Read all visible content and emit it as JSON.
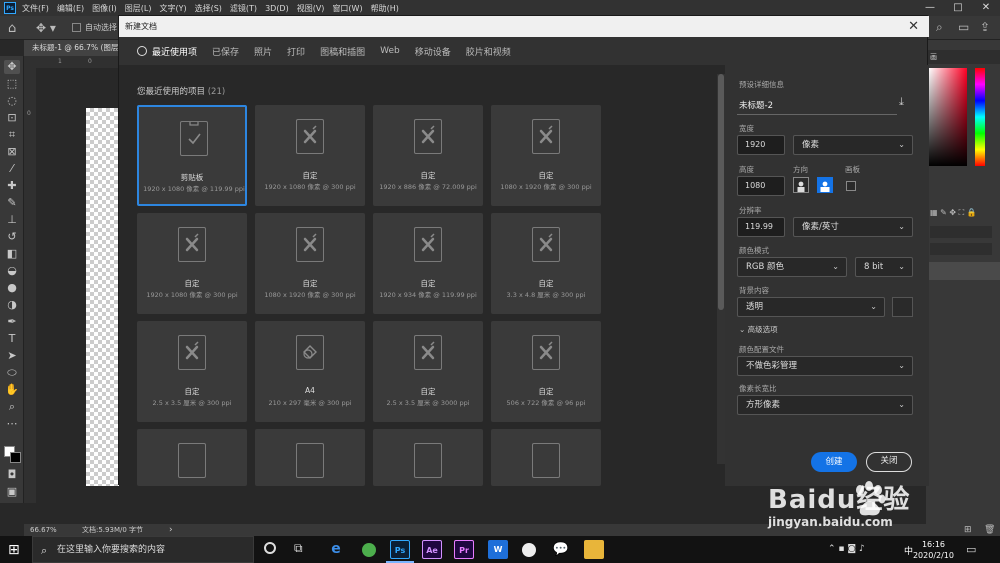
{
  "app": {
    "logo": "Ps",
    "menu": [
      "文件(F)",
      "编辑(E)",
      "图像(I)",
      "图层(L)",
      "文字(Y)",
      "选择(S)",
      "滤镜(T)",
      "3D(D)",
      "视图(V)",
      "窗口(W)",
      "帮助(H)"
    ],
    "window_controls": [
      "—",
      "□",
      "✕"
    ],
    "options_bar": {
      "auto_select_label": "自动选择"
    },
    "doc_tab": "未标题-1 @ 66.7% (图层",
    "ruler_h": [
      "1",
      "0"
    ],
    "ruler_v": [
      "0"
    ],
    "status": {
      "zoom": "66.67%",
      "doc_info": "文档:5.93M/0 字节"
    },
    "right_panel": {
      "tab": "画"
    }
  },
  "dialog": {
    "title": "新建文档",
    "close": "✕",
    "tabs": [
      "最近使用项",
      "已保存",
      "照片",
      "打印",
      "图稿和插图",
      "Web",
      "移动设备",
      "胶片和视频"
    ],
    "recent_label": "您最近使用的项目",
    "recent_count": "(21)",
    "cards": [
      {
        "name": "剪贴板",
        "info": "1920 x 1080 像素 @ 119.99 ppi",
        "icon": "clipboard-icon"
      },
      {
        "name": "自定",
        "info": "1920 x 1080 像素 @ 300 ppi",
        "icon": "custom-doc-icon"
      },
      {
        "name": "自定",
        "info": "1920 x 886 像素 @ 72.009 ppi",
        "icon": "custom-doc-icon"
      },
      {
        "name": "自定",
        "info": "1080 x 1920 像素 @ 300 ppi",
        "icon": "custom-doc-icon"
      },
      {
        "name": "自定",
        "info": "1920 x 1080 像素 @ 300 ppi",
        "icon": "custom-doc-icon"
      },
      {
        "name": "自定",
        "info": "1080 x 1920 像素 @ 300 ppi",
        "icon": "custom-doc-icon"
      },
      {
        "name": "自定",
        "info": "1920 x 934 像素 @ 119.99 ppi",
        "icon": "custom-doc-icon"
      },
      {
        "name": "自定",
        "info": "3.3 x 4.8 厘米 @ 300 ppi",
        "icon": "custom-doc-icon"
      },
      {
        "name": "自定",
        "info": "2.5 x 3.5 厘米 @ 300 ppi",
        "icon": "custom-doc-icon"
      },
      {
        "name": "A4",
        "info": "210 x 297 毫米 @ 300 ppi",
        "icon": "a4-doc-icon"
      },
      {
        "name": "自定",
        "info": "2.5 x 3.5 厘米 @ 3000 ppi",
        "icon": "custom-doc-icon"
      },
      {
        "name": "自定",
        "info": "506 x 722 像素 @ 96 ppi",
        "icon": "custom-doc-icon"
      }
    ],
    "preset_label": "预设详细信息",
    "doc_name": "未标题-2",
    "width_label": "宽度",
    "width_value": "1920",
    "width_unit": "像素",
    "height_label": "高度",
    "height_value": "1080",
    "orientation_label": "方向",
    "artboard_label": "画板",
    "resolution_label": "分辨率",
    "resolution_value": "119.99",
    "resolution_unit": "像素/英寸",
    "color_mode_label": "颜色模式",
    "color_mode": "RGB 颜色",
    "bit_depth": "8 bit",
    "bg_label": "背景内容",
    "bg_value": "透明",
    "advanced_label": "高级选项",
    "profile_label": "颜色配置文件",
    "profile_value": "不做色彩管理",
    "pixel_ratio_label": "像素长宽比",
    "pixel_ratio_value": "方形像素",
    "create_label": "创建",
    "close_label": "关闭"
  },
  "taskbar": {
    "search_placeholder": "在这里输入你要搜索的内容",
    "time": "16:16",
    "date": "2020/2/10",
    "ime": "中"
  },
  "watermark": {
    "text": "Baidu经验",
    "url": "jingyan.baidu.com"
  },
  "colors": {
    "accent": "#1473e6",
    "ps_blue": "#31a8ff"
  }
}
